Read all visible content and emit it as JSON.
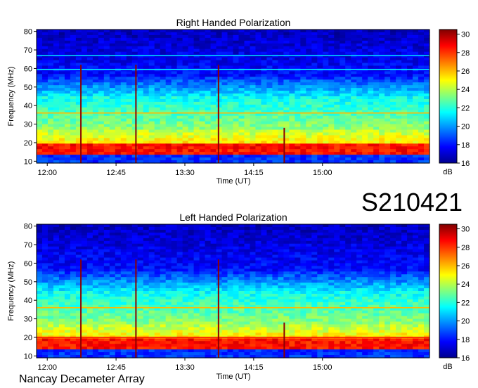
{
  "header": {
    "event_id": "S210421"
  },
  "footer": {
    "credit": "Nancay Decameter Array"
  },
  "colorbar_unit": "dB",
  "chart_data": [
    {
      "type": "heatmap",
      "title": "Right Handed Polarization",
      "xlabel": "Time (UT)",
      "ylabel": "Frequency (MHz)",
      "x_ticks": [
        "12:00",
        "12:45",
        "13:30",
        "14:15",
        "15:00"
      ],
      "x_range": [
        "11:53",
        "16:10"
      ],
      "y_ticks": [
        10,
        20,
        30,
        40,
        50,
        60,
        70,
        80
      ],
      "ylim": [
        9,
        81
      ],
      "colorbar": {
        "ticks": [
          16,
          18,
          20,
          22,
          24,
          26,
          28,
          30
        ],
        "range": [
          16,
          30.5
        ],
        "unit": "dB",
        "colormap": "jet"
      },
      "bursts_utc": [
        "12:22",
        "12:58",
        "13:52",
        "14:35"
      ],
      "persistent_lines_mhz": [
        67,
        59.5,
        36
      ]
    },
    {
      "type": "heatmap",
      "title": "Left Handed Polarization",
      "xlabel": "Time (UT)",
      "ylabel": "Frequency (MHz)",
      "x_ticks": [
        "12:00",
        "12:45",
        "13:30",
        "14:15",
        "15:00"
      ],
      "x_range": [
        "11:53",
        "16:10"
      ],
      "y_ticks": [
        10,
        20,
        30,
        40,
        50,
        60,
        70,
        80
      ],
      "ylim": [
        9,
        81
      ],
      "colorbar": {
        "ticks": [
          16,
          18,
          20,
          22,
          24,
          26,
          28,
          30
        ],
        "range": [
          16,
          30.5
        ],
        "unit": "dB",
        "colormap": "jet"
      },
      "bursts_utc": [
        "12:22",
        "12:58",
        "13:52",
        "14:35"
      ],
      "persistent_lines_mhz": [
        36,
        20
      ]
    }
  ]
}
